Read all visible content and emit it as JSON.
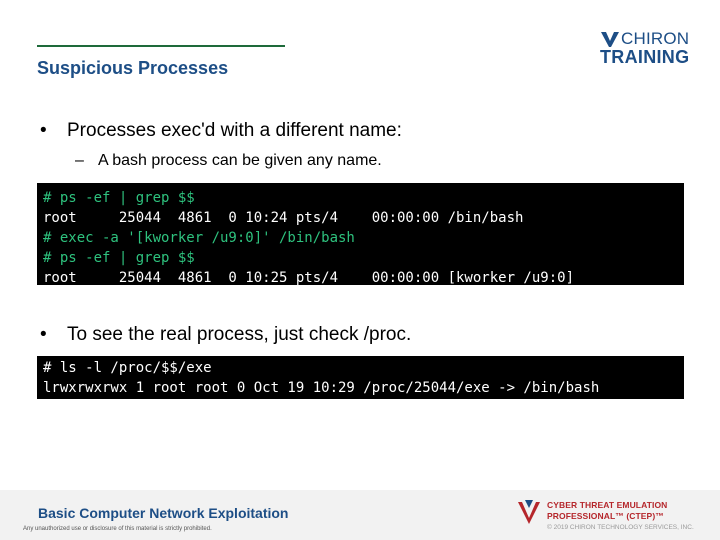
{
  "slide": {
    "title": "Suspicious Processes",
    "bullets": [
      {
        "marker": "•",
        "text": "Processes exec'd with a different name:",
        "sub": [
          {
            "marker": "–",
            "text": "A bash process can be given any name."
          }
        ]
      },
      {
        "marker": "•",
        "text": "To see the real process, just check /proc."
      }
    ],
    "terminal_1": [
      {
        "text": "# ps -ef | grep $$",
        "color": "green"
      },
      {
        "text": "root     25044  4861  0 10:24 pts/4    00:00:00 /bin/bash",
        "color": "white"
      },
      {
        "text": "# exec -a '[kworker /u9:0]' /bin/bash",
        "color": "green"
      },
      {
        "text": "# ps -ef | grep $$",
        "color": "green"
      },
      {
        "text": "root     25044  4861  0 10:25 pts/4    00:00:00 [kworker /u9:0]",
        "color": "white"
      }
    ],
    "terminal_2": [
      {
        "text": "# ls -l /proc/$$/exe",
        "color": "white"
      },
      {
        "text": "lrwxrwxrwx 1 root root 0 Oct 19 10:29 /proc/25044/exe -> /bin/bash",
        "color": "white"
      }
    ]
  },
  "logo": {
    "word1": "CHIRON",
    "word2": "TRAINING",
    "color": "#1d4e86"
  },
  "footer": {
    "course": "Basic Computer Network Exploitation",
    "notice": "Any unauthorized use or disclosure of this material is strictly prohibited.",
    "cert_line1": "CYBER THREAT EMULATION",
    "cert_line2": "PROFESSIONAL™ (CTEP)™",
    "copyright": "© 2019 CHIRON TECHNOLOGY SERVICES, INC.",
    "cert_color": "#b5262b"
  },
  "colors": {
    "accent_green": "#1e6a3a",
    "terminal_green": "#2ec27e",
    "title_blue": "#1d4e86"
  }
}
